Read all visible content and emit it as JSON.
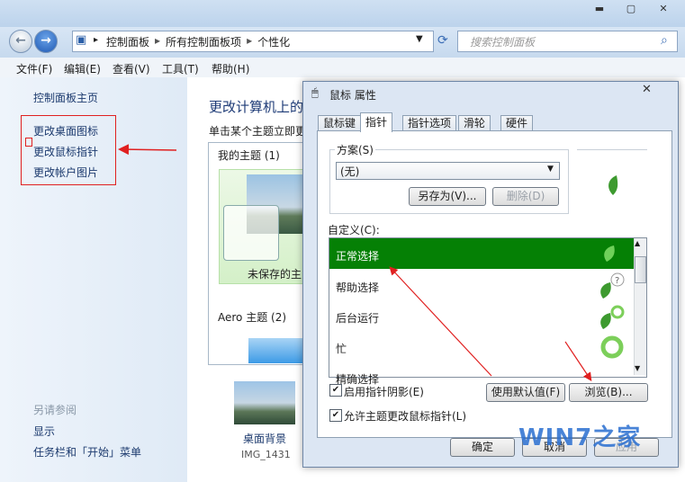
{
  "address": {
    "breadcrumbs": [
      "控制面板",
      "所有控制面板项",
      "个性化"
    ],
    "search_placeholder": "搜索控制面板"
  },
  "menu": [
    "文件(F)",
    "编辑(E)",
    "查看(V)",
    "工具(T)",
    "帮助(H)"
  ],
  "left_pane": {
    "home": "控制面板主页",
    "links": [
      "更改桌面图标",
      "更改鼠标指针",
      "更改帐户图片"
    ],
    "see_also": "另请参阅",
    "see_also_links": [
      "显示",
      "任务栏和「开始」菜单"
    ]
  },
  "main": {
    "title": "更改计算机上的",
    "subtitle": "单击某个主题立即更",
    "my_themes": "我的主题 (1)",
    "unsaved_theme": "未保存的主",
    "aero_themes": "Aero 主题 (2)",
    "desktop_background": "桌面背景",
    "desktop_image": "IMG_1431"
  },
  "dialog": {
    "title": "鼠标 属性",
    "tabs": [
      "鼠标键",
      "指针",
      "指针选项",
      "滑轮",
      "硬件"
    ],
    "active_tab": "指针",
    "scheme_label": "方案(S)",
    "scheme_value": "(无)",
    "save_as": "另存为(V)...",
    "delete": "删除(D)",
    "customize_label": "自定义(C):",
    "cursors": [
      "正常选择",
      "帮助选择",
      "后台运行",
      "忙",
      "精确选择"
    ],
    "enable_shadow": "启用指针阴影(E)",
    "use_default": "使用默认值(F)",
    "browse": "浏览(B)...",
    "allow_themes": "允许主题更改鼠标指针(L)",
    "ok": "确定",
    "cancel": "取消",
    "apply": "应用"
  },
  "watermark": "WIN7之家",
  "colors": {
    "selection": "#058005",
    "annotation": "#e02020",
    "link": "#1c3a6e"
  }
}
